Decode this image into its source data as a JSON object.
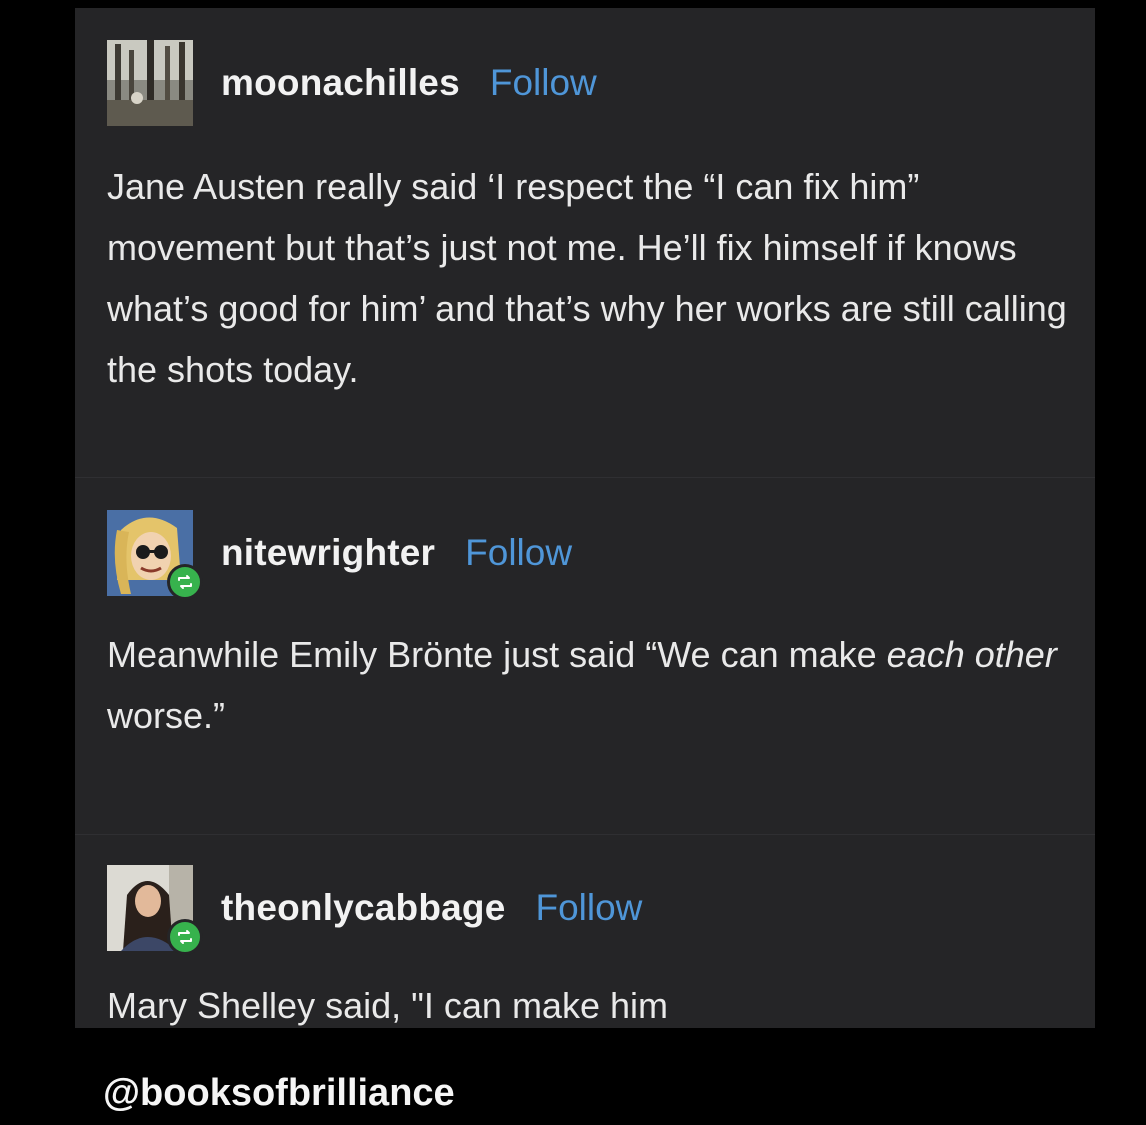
{
  "posts": [
    {
      "username": "moonachilles",
      "follow_label": "Follow",
      "avatar_icon": "forest-photo-avatar",
      "reblogged": false,
      "text": "Jane Austen really said ‘I respect the “I can fix him” movement but that’s just not me. He’ll fix himself if knows what’s good for him’ and that’s why her works are still calling the shots today."
    },
    {
      "username": "nitewrighter",
      "follow_label": "Follow",
      "avatar_icon": "cartoon-character-avatar",
      "reblogged": true,
      "reblog_icon": "reblog-icon",
      "text_before": "Meanwhile Emily Brönte just said “We can make ",
      "text_italic_1": "each",
      "text_italic_2": "other",
      "text_after": " worse.”"
    },
    {
      "username": "theonlycabbage",
      "follow_label": "Follow",
      "avatar_icon": "person-photo-avatar",
      "reblogged": true,
      "reblog_icon": "reblog-icon",
      "text": "Mary Shelley said, \"I can make him"
    }
  ],
  "watermark": "@booksofbrilliance",
  "colors": {
    "panel_bg": "#252527",
    "page_bg": "#000000",
    "follow": "#4f96d8",
    "reblog_badge": "#37b24d"
  }
}
